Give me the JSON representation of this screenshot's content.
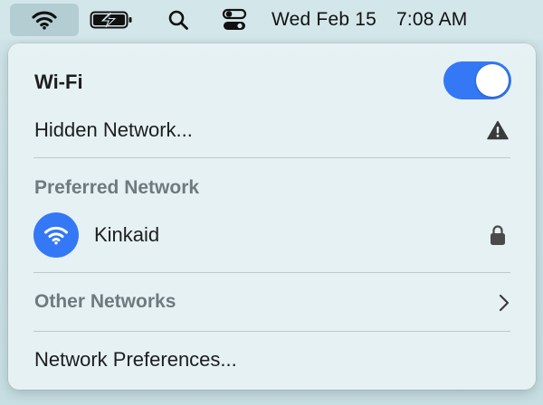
{
  "menubar": {
    "icons": [
      "wifi-icon",
      "battery-charging-icon",
      "search-icon",
      "control-center-icon"
    ],
    "date": "Wed Feb 15",
    "time": "7:08 AM"
  },
  "panel": {
    "wifi_label": "Wi-Fi",
    "wifi_enabled": true,
    "hidden_network_label": "Hidden Network...",
    "preferred_section": "Preferred Network",
    "preferred_networks": [
      {
        "name": "Kinkaid",
        "secured": true,
        "connected": true
      }
    ],
    "other_section": "Other Networks",
    "preferences_label": "Network Preferences..."
  },
  "colors": {
    "accent": "#3478f6",
    "section_text": "#6f7a7e",
    "menubar_bg": "#d3e6ea",
    "panel_bg": "#e6f2f4"
  }
}
